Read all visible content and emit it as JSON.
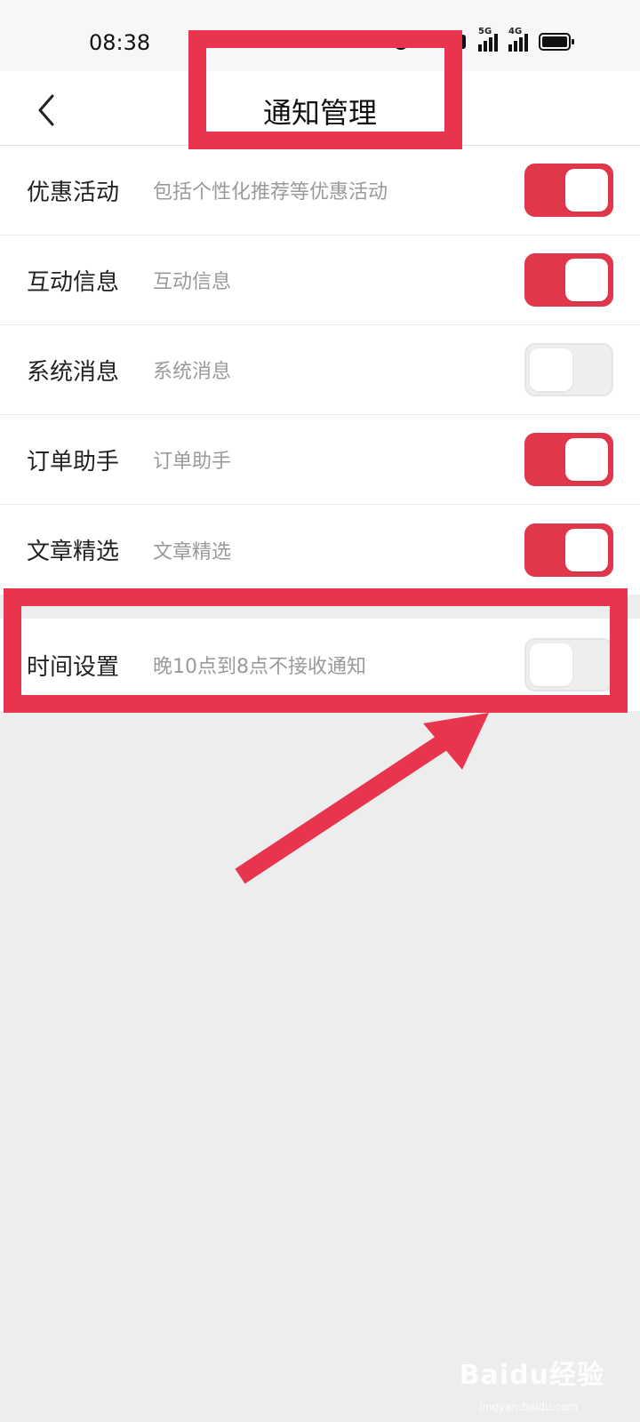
{
  "status_bar": {
    "time": "08:38",
    "sig1_label": "5G",
    "sig2_label": "4G"
  },
  "nav": {
    "title": "通知管理"
  },
  "rows": [
    {
      "title": "优惠活动",
      "desc": "包括个性化推荐等优惠活动",
      "on": true
    },
    {
      "title": "互动信息",
      "desc": "互动信息",
      "on": true
    },
    {
      "title": "系统消息",
      "desc": "系统消息",
      "on": false
    },
    {
      "title": "订单助手",
      "desc": "订单助手",
      "on": true
    },
    {
      "title": "文章精选",
      "desc": "文章精选",
      "on": true
    }
  ],
  "time_setting": {
    "title": "时间设置",
    "desc": "晚10点到8点不接收通知",
    "on": false
  },
  "colors": {
    "accent": "#e0374a",
    "annotation": "#e8344d"
  },
  "watermark": {
    "brand": "Baidu经验",
    "url": "jingyan.baidu.com"
  }
}
